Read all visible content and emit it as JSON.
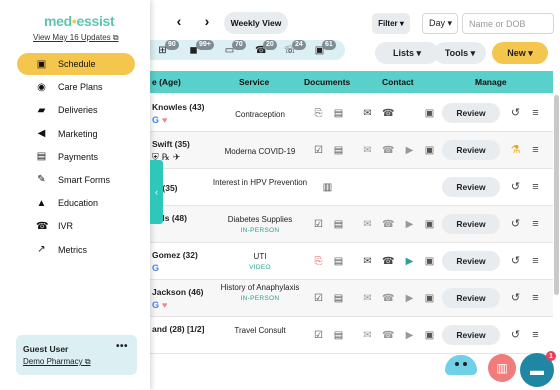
{
  "brand": {
    "name_left": "med",
    "name_right": "essist",
    "updates_link": "View May 16 Updates"
  },
  "sidebar": {
    "items": [
      {
        "label": "Schedule",
        "icon": "calendar-icon",
        "glyph": "▣",
        "active": true
      },
      {
        "label": "Care Plans",
        "icon": "people-icon",
        "glyph": "👥"
      },
      {
        "label": "Deliveries",
        "icon": "truck-icon",
        "glyph": "🚚"
      },
      {
        "label": "Marketing",
        "icon": "megaphone-icon",
        "glyph": "📢"
      },
      {
        "label": "Payments",
        "icon": "payment-icon",
        "glyph": "▤"
      },
      {
        "label": "Smart Forms",
        "icon": "form-icon",
        "glyph": "✎"
      },
      {
        "label": "Education",
        "icon": "graduation-icon",
        "glyph": "🎓"
      },
      {
        "label": "IVR",
        "icon": "phone-icon",
        "glyph": "☎"
      },
      {
        "label": "Metrics",
        "icon": "trend-icon",
        "glyph": "↗"
      }
    ],
    "user": {
      "name": "Guest User",
      "pharmacy": "Demo Pharmacy",
      "more": "•••"
    }
  },
  "topbar": {
    "prev": "‹",
    "next": "›",
    "view_button": "Weekly View",
    "filter_button": "Filter ▾",
    "day_select": "Day ▾",
    "search_placeholder": "Name or DOB"
  },
  "badges": [
    {
      "icon": "intake-icon",
      "glyph": "⊞",
      "count": "90"
    },
    {
      "icon": "box-icon",
      "glyph": "◼",
      "count": "99+"
    },
    {
      "icon": "folder-icon",
      "glyph": "▭",
      "count": "70"
    },
    {
      "icon": "phone-icon",
      "glyph": "☎",
      "count": "20"
    },
    {
      "icon": "missed-call-icon",
      "glyph": "☏",
      "count": "24"
    },
    {
      "icon": "chat-icon",
      "glyph": "▣",
      "count": "61"
    }
  ],
  "actions": {
    "lists": "Lists ▾",
    "tools": "Tools ▾",
    "new": "New ▾"
  },
  "table": {
    "headers": {
      "name": "e (Age)",
      "service": "Service",
      "documents": "Documents",
      "contact": "Contact",
      "manage": "Manage"
    },
    "rows": [
      {
        "name": "Knowles (43)",
        "service": "Contraception",
        "tag": "",
        "review": "Review"
      },
      {
        "name": "Swift (35)",
        "service": "Moderna COVID-19",
        "tag": "",
        "review": "Review"
      },
      {
        "name": "ift (35)",
        "service": "Interest in HPV Prevention",
        "tag": "",
        "review": "Review"
      },
      {
        "name": "olds (48)",
        "service": "Diabetes Supplies",
        "tag": "IN-PERSON",
        "review": "Review"
      },
      {
        "name": "Gomez (32)",
        "service": "UTI",
        "tag": "VIDEO",
        "review": "Review"
      },
      {
        "name": "Jackson (46)",
        "service": "History of Anaphylaxis",
        "tag": "IN-PERSON",
        "review": "Review"
      },
      {
        "name": "and (28) [1/2]",
        "service": "Travel Consult",
        "tag": "",
        "review": "Review"
      }
    ]
  },
  "floating": {
    "notification_count": "1"
  }
}
